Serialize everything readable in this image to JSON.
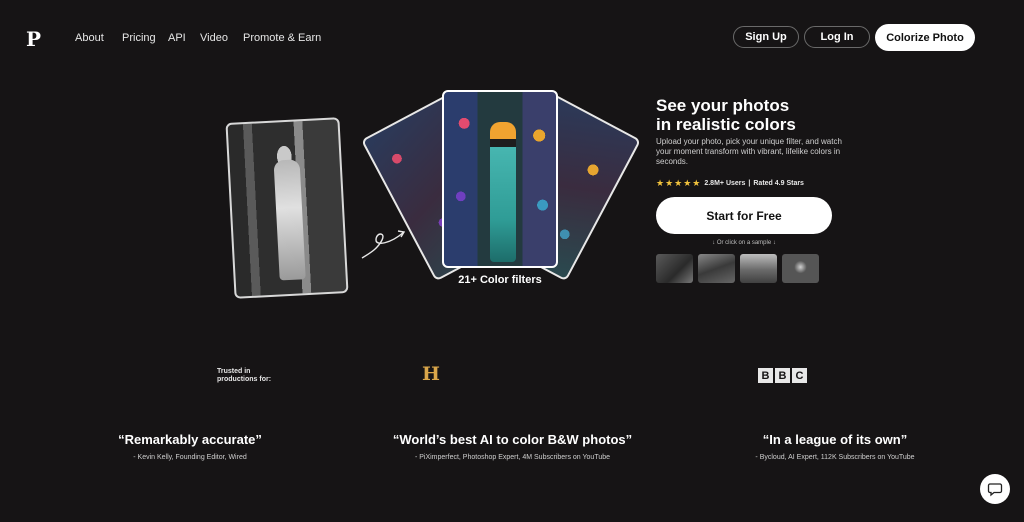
{
  "header": {
    "logo": "P",
    "nav": [
      "About",
      "Pricing",
      "API",
      "Video",
      "Promote & Earn"
    ],
    "signup_label": "Sign Up",
    "login_label": "Log In",
    "colorize_label": "Colorize Photo"
  },
  "hero": {
    "filters_label": "21+ Color filters",
    "title_line1": "See your photos",
    "title_line2": "in realistic colors",
    "description": "Upload your photo, pick your unique filter, and watch your moment transform with vibrant, lifelike colors in seconds.",
    "stars": "★★★★★",
    "users": "2.8M+ Users",
    "rating_sep": "|",
    "rated": "Rated 4.9 Stars",
    "cta_label": "Start for Free",
    "sample_hint": "↓ Or click on a sample ↓"
  },
  "trusted": {
    "label": "Trusted in productions for:",
    "history_logo": "H",
    "bbc_letters": [
      "B",
      "B",
      "C"
    ]
  },
  "quotes": [
    {
      "text": "“Remarkably accurate”",
      "source": "- Kevin Kelly, Founding Editor, Wired"
    },
    {
      "text": "“World’s best AI to color B&W photos”",
      "source": "- PiXimperfect, Photoshop Expert, 4M Subscribers on YouTube"
    },
    {
      "text": "“In a league of its own”",
      "source": "- Bycloud, AI Expert, 112K Subscribers on YouTube"
    }
  ],
  "icons": {
    "chat": "chat-bubble-icon",
    "arrow": "swirl-arrow-icon"
  }
}
